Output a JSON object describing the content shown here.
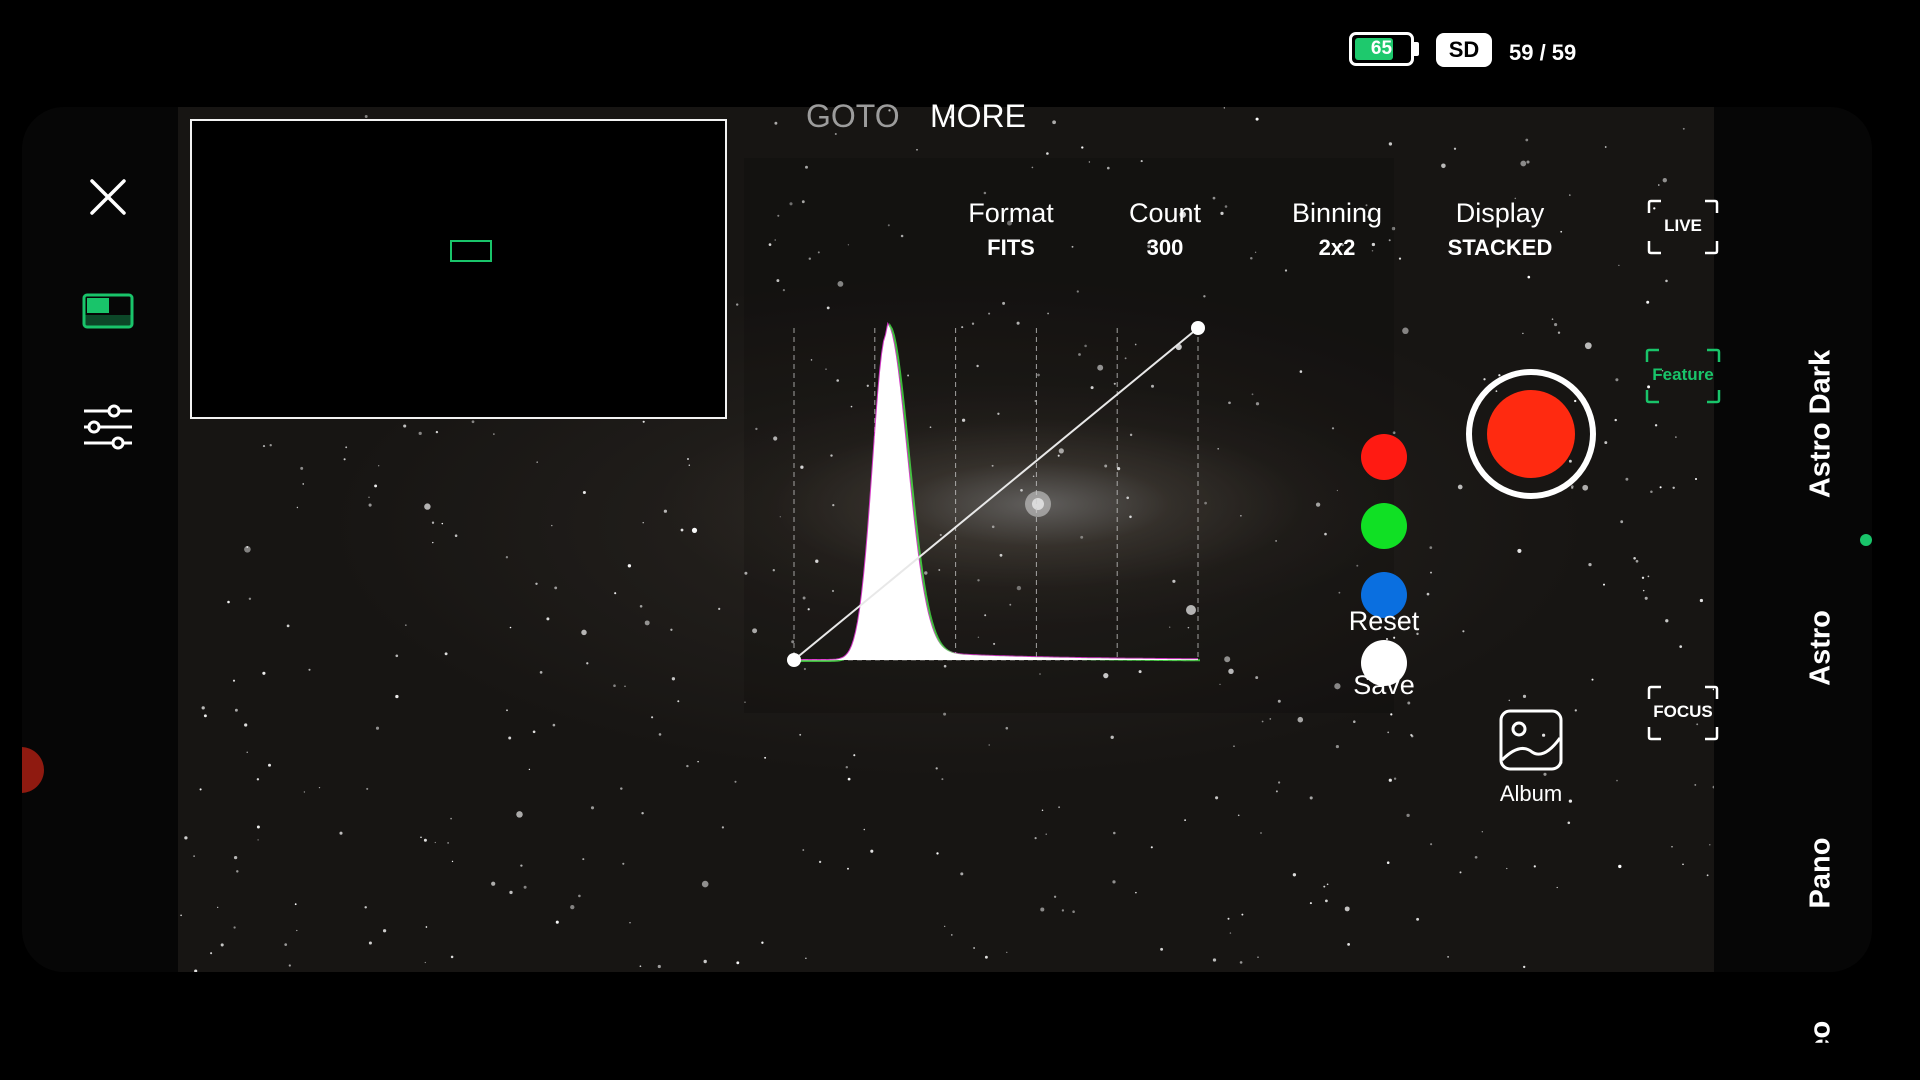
{
  "status": {
    "battery_level": "65",
    "battery_fraction": 0.72,
    "storage_badge": "SD",
    "storage_count": "59 / 59"
  },
  "tabs": [
    {
      "label": "GOTO",
      "active": false
    },
    {
      "label": "MORE",
      "active": true
    }
  ],
  "settings": [
    {
      "label": "Format",
      "value": "FITS"
    },
    {
      "label": "Count",
      "value": "300"
    },
    {
      "label": "Binning",
      "value": "2x2"
    },
    {
      "label": "Display",
      "value": "STACKED"
    }
  ],
  "histogram": {
    "curve_start": [
      0,
      0
    ],
    "curve_end": [
      1,
      1
    ]
  },
  "channels": [
    {
      "name": "red-channel",
      "color": "#ff1a12"
    },
    {
      "name": "green-channel",
      "color": "#10e024"
    },
    {
      "name": "blue-channel",
      "color": "#0a6fe0"
    },
    {
      "name": "luminance-channel",
      "color": "#ffffff"
    }
  ],
  "actions": {
    "reset_label": "Reset",
    "save_label": "Save"
  },
  "right_controls": {
    "live_label": "LIVE",
    "feature_label": "Feature",
    "focus_label": "FOCUS",
    "album_label": "Album",
    "shutter_color": "#ff2a10"
  },
  "modes": [
    {
      "label": "Astro Dark",
      "active": false
    },
    {
      "label": "Astro",
      "active": true
    },
    {
      "label": "Pano",
      "active": false
    },
    {
      "label": "Video",
      "active": false
    }
  ],
  "accent_color": "#19c46a",
  "left_bar": {
    "icons": [
      "close-icon",
      "picture-in-picture-icon",
      "sliders-icon"
    ]
  }
}
